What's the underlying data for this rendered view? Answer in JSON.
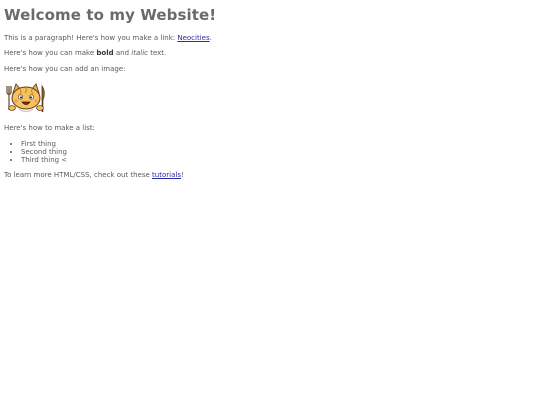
{
  "heading": "Welcome to my Website!",
  "paragraph1": {
    "before": "This is a paragraph! Here's how you make a link: ",
    "link": "Neocities",
    "after": "."
  },
  "paragraph2": {
    "before": "Here's how you can make ",
    "bold": "bold",
    "middle": " and ",
    "italic": "italic",
    "after": " text."
  },
  "paragraph3": "Here's how you can add an image:",
  "image": {
    "icon": "neocities-cat-mascot"
  },
  "paragraph4": "Here's how to make a list:",
  "list": [
    "First thing",
    "Second thing",
    "Third thing <"
  ],
  "paragraph5": {
    "before": "To learn more HTML/CSS, check out these ",
    "link": "tutorials",
    "after": "!"
  },
  "colors": {
    "text": "#5a5a5a",
    "heading": "#6a6a6a",
    "link": "#2a2aa8"
  }
}
